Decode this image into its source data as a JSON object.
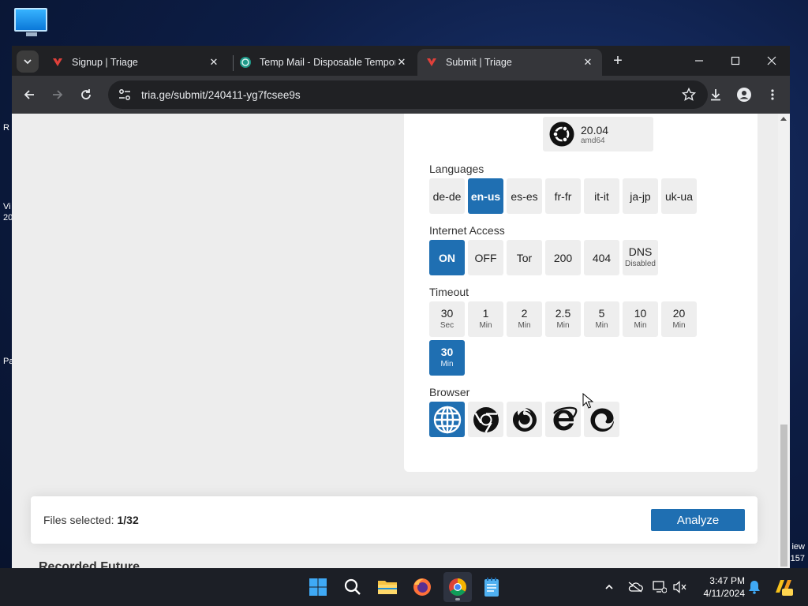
{
  "desktop": {
    "edge_texts_left": [
      "R",
      "Vi",
      "20",
      "Pa"
    ],
    "edge_texts_right": [
      "iew",
      "157"
    ]
  },
  "tabs": [
    {
      "title": "Signup | Triage",
      "icon": "triage-icon",
      "active": false
    },
    {
      "title": "Temp Mail - Disposable Tempor",
      "icon": "tempmail-icon",
      "active": false
    },
    {
      "title": "Submit | Triage",
      "icon": "triage-icon",
      "active": true
    }
  ],
  "toolbar": {
    "url": "tria.ge/submit/240411-yg7fcsee9s"
  },
  "os": {
    "version": "20.04",
    "arch": "amd64"
  },
  "languages": {
    "label": "Languages",
    "options": [
      "de-de",
      "en-us",
      "es-es",
      "fr-fr",
      "it-it",
      "ja-jp",
      "uk-ua"
    ],
    "selected": "en-us"
  },
  "internet": {
    "label": "Internet Access",
    "options": [
      {
        "main": "ON",
        "sub": ""
      },
      {
        "main": "OFF",
        "sub": ""
      },
      {
        "main": "Tor",
        "sub": ""
      },
      {
        "main": "200",
        "sub": ""
      },
      {
        "main": "404",
        "sub": ""
      },
      {
        "main": "DNS",
        "sub": "Disabled"
      }
    ],
    "selected": "ON"
  },
  "timeout": {
    "label": "Timeout",
    "options": [
      {
        "main": "30",
        "sub": "Sec"
      },
      {
        "main": "1",
        "sub": "Min"
      },
      {
        "main": "2",
        "sub": "Min"
      },
      {
        "main": "2.5",
        "sub": "Min"
      },
      {
        "main": "5",
        "sub": "Min"
      },
      {
        "main": "10",
        "sub": "Min"
      },
      {
        "main": "20",
        "sub": "Min"
      },
      {
        "main": "30",
        "sub": "Min"
      }
    ],
    "selected_index": 7
  },
  "browser": {
    "label": "Browser",
    "options": [
      "globe-icon",
      "chrome-icon",
      "firefox-icon",
      "internet-explorer-icon",
      "edge-icon"
    ],
    "selected": "globe-icon"
  },
  "footer": {
    "files_label": "Files selected:",
    "files_count": "1/32",
    "analyze_label": "Analyze"
  },
  "peek": {
    "text": "Recorded Future"
  },
  "taskbar": {
    "apps": [
      "windows-start-icon",
      "search-icon",
      "file-explorer-icon",
      "firefox-icon",
      "chrome-icon",
      "notepad-icon"
    ],
    "active_app": "chrome-icon",
    "time": "3:47 PM",
    "date": "4/11/2024"
  },
  "colors": {
    "accent": "#1f6fb2",
    "chip": "#eeeeee",
    "page_bg": "#ededed"
  }
}
